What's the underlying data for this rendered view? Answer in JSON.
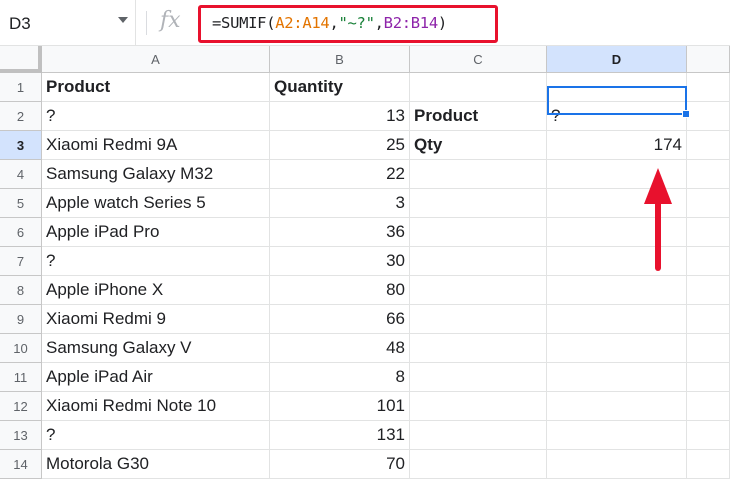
{
  "name_box": {
    "ref": "D3"
  },
  "formula_bar": {
    "fx_label": "fx",
    "parts": [
      {
        "text": "=SUMIF(",
        "color": "default"
      },
      {
        "text": "A2:A14",
        "color": "orange"
      },
      {
        "text": ",",
        "color": "default"
      },
      {
        "text": "\"~?\"",
        "color": "green"
      },
      {
        "text": ",",
        "color": "default"
      },
      {
        "text": "B2:B14",
        "color": "purple"
      },
      {
        "text": ")",
        "color": "default"
      }
    ]
  },
  "columns": [
    "A",
    "B",
    "C",
    "D"
  ],
  "rows": [
    {
      "num": "1",
      "a": "Product",
      "b": "Quantity",
      "c": "",
      "d": ""
    },
    {
      "num": "2",
      "a": "?",
      "b": "13",
      "c": "Product",
      "d": "?"
    },
    {
      "num": "3",
      "a": "Xiaomi Redmi 9A",
      "b": "25",
      "c": "Qty",
      "d": "174"
    },
    {
      "num": "4",
      "a": "Samsung Galaxy M32",
      "b": "22",
      "c": "",
      "d": ""
    },
    {
      "num": "5",
      "a": "Apple watch Series 5",
      "b": "3",
      "c": "",
      "d": ""
    },
    {
      "num": "6",
      "a": "Apple iPad Pro",
      "b": "36",
      "c": "",
      "d": ""
    },
    {
      "num": "7",
      "a": "?",
      "b": "30",
      "c": "",
      "d": ""
    },
    {
      "num": "8",
      "a": "Apple iPhone X",
      "b": "80",
      "c": "",
      "d": ""
    },
    {
      "num": "9",
      "a": "Xiaomi Redmi 9",
      "b": "66",
      "c": "",
      "d": ""
    },
    {
      "num": "10",
      "a": "Samsung Galaxy V",
      "b": "48",
      "c": "",
      "d": ""
    },
    {
      "num": "11",
      "a": "Apple iPad Air",
      "b": "8",
      "c": "",
      "d": ""
    },
    {
      "num": "12",
      "a": "Xiaomi Redmi Note 10",
      "b": "101",
      "c": "",
      "d": ""
    },
    {
      "num": "13",
      "a": "?",
      "b": "131",
      "c": "",
      "d": ""
    },
    {
      "num": "14",
      "a": "Motorola G30",
      "b": "70",
      "c": "",
      "d": ""
    }
  ],
  "selected_cell": "D3",
  "colors": {
    "highlight_box": "#e8112d",
    "arrow": "#e8112d",
    "selection": "#1a73e8"
  }
}
